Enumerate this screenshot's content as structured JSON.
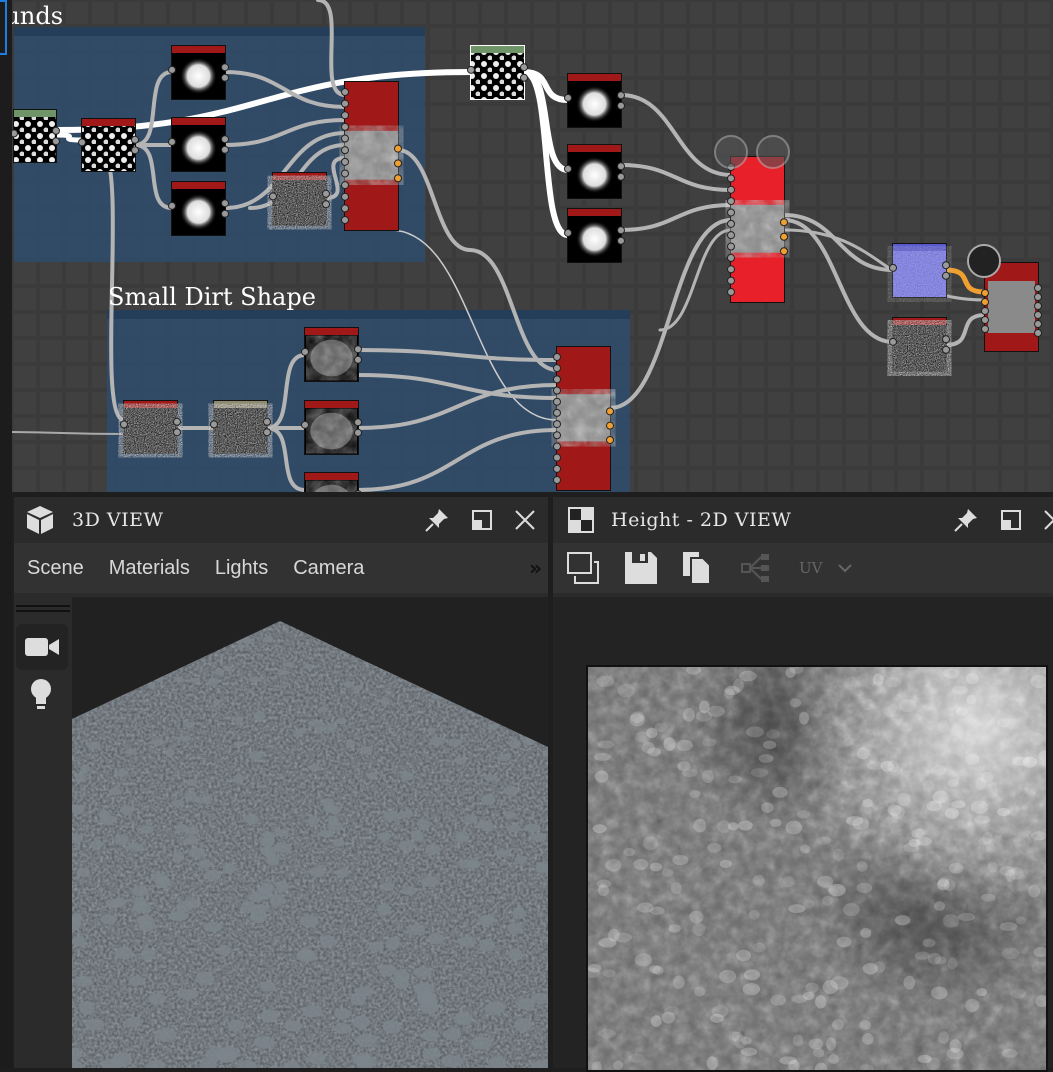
{
  "graph": {
    "swatch_colors": [
      "#6e4e6e",
      "#c8c8c8",
      "#8e8a6e",
      "#4e4636",
      "#5e7a24",
      "#6a6236",
      "#3e6a6e",
      "#a2ba5a",
      "#6e5e96"
    ],
    "frames": [
      {
        "title": "ounds",
        "color": "#2f4c6c"
      },
      {
        "title": "Small Dirt Shape",
        "color": "#2f4c6c"
      }
    ],
    "node_header_colors": {
      "red": "#a01818",
      "bright_red": "#e8202a",
      "green": "#6e9468",
      "khaki": "#8e8a6e"
    }
  },
  "view3d": {
    "title": "3D VIEW",
    "icon": "cube-icon",
    "menu": [
      "Scene",
      "Materials",
      "Lights",
      "Camera"
    ],
    "overflow": "»",
    "side_tools": [
      "camera-icon",
      "lightbulb-icon"
    ]
  },
  "view2d": {
    "title": "Height - 2D VIEW",
    "icon": "checker-icon",
    "toolbar": [
      "copy-image-icon",
      "save-icon",
      "copy-icon",
      "share-graph-icon"
    ],
    "uv_label": "UV"
  },
  "colors": {
    "panel": "#2b2b2b",
    "toolbar": "#323232",
    "graph_bg": "#3b3b3b",
    "accent": "#1e7fe0"
  }
}
